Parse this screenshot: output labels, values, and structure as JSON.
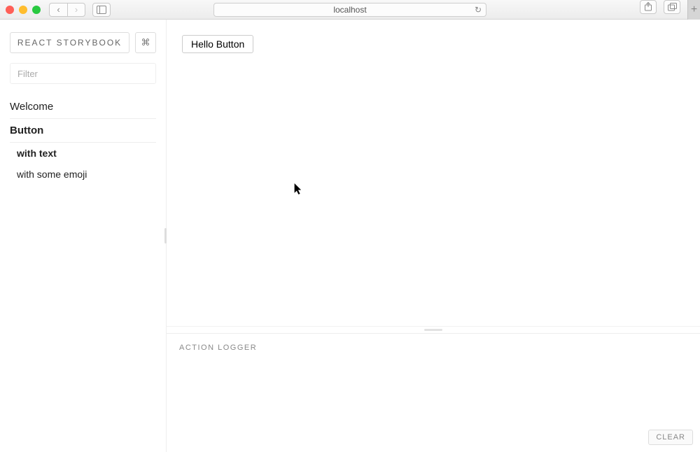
{
  "browser": {
    "url": "localhost"
  },
  "sidebar": {
    "brand": "REACT STORYBOOK",
    "shortcut_symbol": "⌘",
    "filter_placeholder": "Filter",
    "kinds": [
      {
        "name": "Welcome",
        "active": false,
        "stories": []
      },
      {
        "name": "Button",
        "active": true,
        "stories": [
          {
            "name": "with text",
            "active": true
          },
          {
            "name": "with some emoji",
            "active": false
          }
        ]
      }
    ]
  },
  "preview": {
    "button_text": "Hello Button"
  },
  "logger": {
    "title": "ACTION LOGGER",
    "clear_label": "CLEAR"
  }
}
